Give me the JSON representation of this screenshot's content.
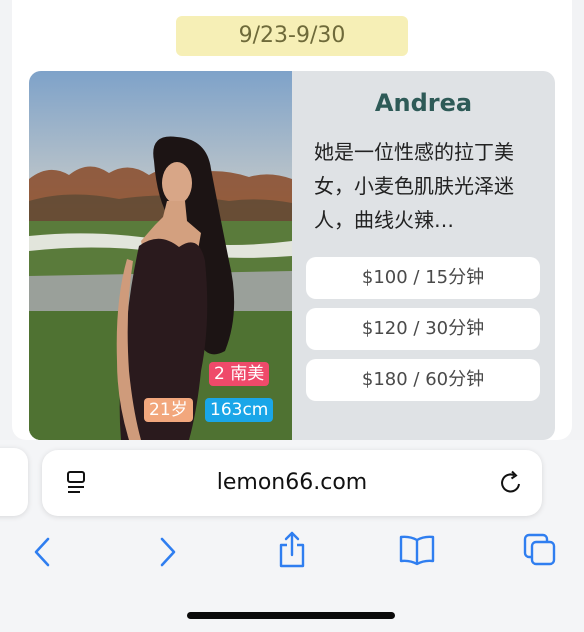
{
  "date_range": "9/23-9/30",
  "profile": {
    "name": "Andrea",
    "description": "她是一位性感的拉丁美女，小麦色肌肤光泽迷人，曲线火辣…",
    "tags": {
      "region": "2 南美",
      "age": "21岁",
      "height": "163cm"
    },
    "prices": [
      {
        "label": "$100 / 15分钟"
      },
      {
        "label": "$120 / 30分钟"
      },
      {
        "label": "$180 / 60分钟"
      }
    ]
  },
  "browser": {
    "url": "lemon66.com",
    "icons": {
      "page_menu": "page-menu-icon",
      "reload": "reload-icon",
      "back": "back-chevron-icon",
      "forward": "forward-chevron-icon",
      "share": "share-icon",
      "bookmarks": "bookmarks-icon",
      "tabs": "tabs-icon"
    },
    "accent_color": "#2f7ef0"
  },
  "colors": {
    "date_pill": "#f6efb6",
    "region_tag": "#ef4a6a",
    "age_tag": "#f2a77d",
    "height_tag": "#1aa6e8",
    "name": "#2e5a57"
  }
}
